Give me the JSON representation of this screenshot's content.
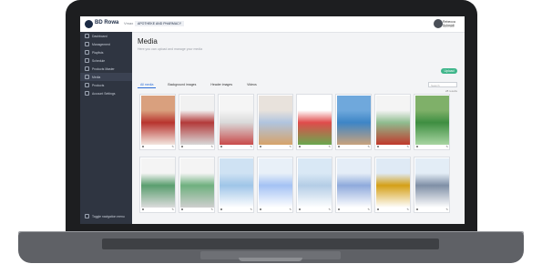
{
  "header": {
    "brand": "BD Rowa",
    "brand_sub": "Vmax",
    "nav_label": "APOTHEKE AND PHARMACY",
    "user_name": "Rebecca Schmidt",
    "user_org": "Apotheke"
  },
  "sidebar": {
    "items": [
      {
        "label": "Dashboard",
        "icon": "dashboard-icon"
      },
      {
        "label": "Management",
        "icon": "management-icon"
      },
      {
        "label": "Playlists",
        "icon": "playlist-icon"
      },
      {
        "label": "Schedule",
        "icon": "calendar-icon"
      },
      {
        "label": "Products Master",
        "icon": "products-icon"
      },
      {
        "label": "Media",
        "icon": "media-icon"
      },
      {
        "label": "Products",
        "icon": "box-icon"
      },
      {
        "label": "Account Settings",
        "icon": "settings-icon"
      }
    ],
    "active_index": 5,
    "toggle_label": "Toggle navigation menu"
  },
  "main": {
    "title": "Media",
    "subtitle": "Here you can upload and manage your media",
    "upload_label": "Upload",
    "tabs": [
      "All media",
      "Background images",
      "Header images",
      "Videos"
    ],
    "active_tab": 0,
    "search_placeholder": "Search",
    "count_label": "28 results"
  },
  "media_items": [
    {
      "colors": [
        "#d9a07e",
        "#b8342e",
        "#f3e6df"
      ]
    },
    {
      "colors": [
        "#f1f1f1",
        "#b33a3a",
        "#d8d8d8"
      ]
    },
    {
      "colors": [
        "#f5f5f5",
        "#d9d9d9",
        "#c94a4a"
      ]
    },
    {
      "colors": [
        "#e8e2dc",
        "#b0c4de",
        "#d6a36a"
      ]
    },
    {
      "colors": [
        "#ffffff",
        "#e04b4b",
        "#6aa84f"
      ]
    },
    {
      "colors": [
        "#6fa8dc",
        "#3d85c6",
        "#c9a27c"
      ]
    },
    {
      "colors": [
        "#f4f4f4",
        "#8fbc8f",
        "#c0392b"
      ]
    },
    {
      "colors": [
        "#7fb069",
        "#3e8e41",
        "#a8d5a2"
      ]
    },
    {
      "colors": [
        "#f4f4f4",
        "#5a9e6f",
        "#dcdcdc"
      ]
    },
    {
      "colors": [
        "#f4f4f4",
        "#6fb07f",
        "#cfcfcf"
      ]
    },
    {
      "colors": [
        "#cfe2f3",
        "#9fc5e8",
        "#ffffff"
      ]
    },
    {
      "colors": [
        "#e8f0f8",
        "#a4c2f4",
        "#ffffff"
      ]
    },
    {
      "colors": [
        "#d9e8f5",
        "#b4cde6",
        "#ffffff"
      ]
    },
    {
      "colors": [
        "#e4edf7",
        "#8faadc",
        "#ffffff"
      ]
    },
    {
      "colors": [
        "#dfeaf5",
        "#d4a017",
        "#ffffff"
      ]
    },
    {
      "colors": [
        "#e3edf6",
        "#7f8fa6",
        "#ffffff"
      ]
    }
  ]
}
